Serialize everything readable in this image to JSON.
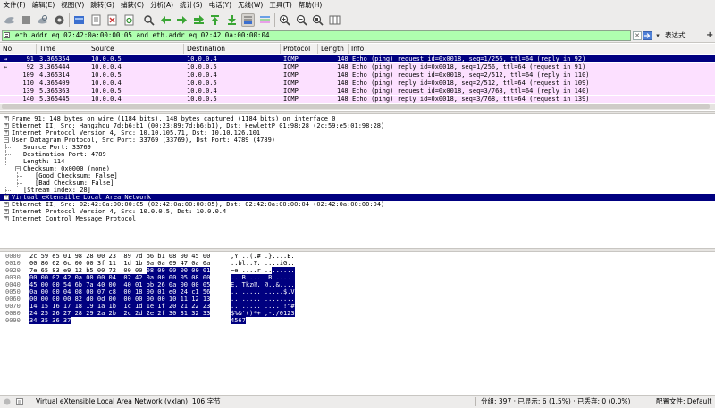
{
  "menu": [
    "文件(F)",
    "编辑(E)",
    "视图(V)",
    "跳转(G)",
    "捕获(C)",
    "分析(A)",
    "统计(S)",
    "电话(Y)",
    "无线(W)",
    "工具(T)",
    "帮助(H)"
  ],
  "toolbar_icons": [
    "shark-start-icon",
    "stop-icon",
    "restart-icon",
    "options-gear-icon",
    "open-file-icon",
    "save-file-icon",
    "close-file-icon",
    "reload-icon",
    "find-icon",
    "go-back-icon",
    "go-forward-icon",
    "go-to-packet-icon",
    "go-first-icon",
    "go-last-icon",
    "autoscroll-icon",
    "colorize-icon",
    "zoom-in-icon",
    "zoom-out-icon",
    "zoom-normal-icon",
    "resize-columns-icon"
  ],
  "filter": {
    "value": "eth.addr eq 02:42:0a:00:00:05 and eth.addr eq 02:42:0a:00:00:04",
    "expression_label": "表达式…",
    "add_label": "+"
  },
  "packet_list": {
    "columns": [
      "No.",
      "Time",
      "Source",
      "Destination",
      "Protocol",
      "Length",
      "Info"
    ],
    "rows": [
      {
        "marker": "→",
        "no": "91",
        "time": "3.365354",
        "src": "10.0.0.5",
        "dst": "10.0.0.4",
        "proto": "ICMP",
        "len": "148",
        "info": "Echo (ping) request  id=0x0018, seq=1/256, ttl=64 (reply in 92)",
        "selected": true
      },
      {
        "marker": "←",
        "no": "92",
        "time": "3.365444",
        "src": "10.0.0.4",
        "dst": "10.0.0.5",
        "proto": "ICMP",
        "len": "148",
        "info": "Echo (ping) reply    id=0x0018, seq=1/256, ttl=64 (request in 91)",
        "selected": false
      },
      {
        "marker": "",
        "no": "109",
        "time": "4.365314",
        "src": "10.0.0.5",
        "dst": "10.0.0.4",
        "proto": "ICMP",
        "len": "148",
        "info": "Echo (ping) request  id=0x0018, seq=2/512, ttl=64 (reply in 110)",
        "selected": false
      },
      {
        "marker": "",
        "no": "110",
        "time": "4.365409",
        "src": "10.0.0.4",
        "dst": "10.0.0.5",
        "proto": "ICMP",
        "len": "148",
        "info": "Echo (ping) reply    id=0x0018, seq=2/512, ttl=64 (request in 109)",
        "selected": false
      },
      {
        "marker": "",
        "no": "139",
        "time": "5.365363",
        "src": "10.0.0.5",
        "dst": "10.0.0.4",
        "proto": "ICMP",
        "len": "148",
        "info": "Echo (ping) request  id=0x0018, seq=3/768, ttl=64 (reply in 140)",
        "selected": false
      },
      {
        "marker": "",
        "no": "140",
        "time": "5.365445",
        "src": "10.0.0.4",
        "dst": "10.0.0.5",
        "proto": "ICMP",
        "len": "148",
        "info": "Echo (ping) reply    id=0x0018, seq=3/768, ttl=64 (request in 139)",
        "selected": false
      }
    ]
  },
  "details": [
    {
      "text": "Frame 91: 148 bytes on wire (1184 bits), 148 bytes captured (1184 bits) on interface 0",
      "level": 0,
      "expander": "+",
      "selected": false
    },
    {
      "text": "Ethernet II, Src: Hangzhou_7d:b6:b1 (00:23:89:7d:b6:b1), Dst: HewlettP_01:98:28 (2c:59:e5:01:98:28)",
      "level": 0,
      "expander": "+",
      "selected": false
    },
    {
      "text": "Internet Protocol Version 4, Src: 10.10.105.71, Dst: 10.10.126.101",
      "level": 0,
      "expander": "+",
      "selected": false
    },
    {
      "text": "User Datagram Protocol, Src Port: 33769 (33769), Dst Port: 4789 (4789)",
      "level": 0,
      "expander": "-",
      "selected": false
    },
    {
      "text": "Source Port: 33769",
      "level": 1,
      "expander": "",
      "selected": false
    },
    {
      "text": "Destination Port: 4789",
      "level": 1,
      "expander": "",
      "selected": false
    },
    {
      "text": "Length: 114",
      "level": 1,
      "expander": "",
      "selected": false
    },
    {
      "text": "Checksum: 0x0000 (none)",
      "level": 1,
      "expander": "-",
      "selected": false
    },
    {
      "text": "[Good Checksum: False]",
      "level": 2,
      "expander": "",
      "selected": false
    },
    {
      "text": "[Bad Checksum: False]",
      "level": 2,
      "expander": "",
      "selected": false
    },
    {
      "text": "[Stream index: 28]",
      "level": 1,
      "expander": "",
      "selected": false
    },
    {
      "text": "Virtual eXtensible Local Area Network",
      "level": 0,
      "expander": "+",
      "selected": true
    },
    {
      "text": "Ethernet II, Src: 02:42:0a:00:00:05 (02:42:0a:00:00:05), Dst: 02:42:0a:00:00:04 (02:42:0a:00:00:04)",
      "level": 0,
      "expander": "+",
      "selected": false
    },
    {
      "text": "Internet Protocol Version 4, Src: 10.0.0.5, Dst: 10.0.0.4",
      "level": 0,
      "expander": "+",
      "selected": false
    },
    {
      "text": "Internet Control Message Protocol",
      "level": 0,
      "expander": "+",
      "selected": false
    }
  ],
  "bytes": [
    {
      "offset": "0000",
      "hex_plain": "2c 59 e5 01 98 28 00 23  89 7d b6 b1 08 00 45 00",
      "hex_hl": "",
      "ascii_plain": ",Y...(.# .}....E.",
      "ascii_hl": ""
    },
    {
      "offset": "0010",
      "hex_plain": "00 86 62 6c 00 00 3f 11  1d 1b 0a 0a 69 47 0a 0a",
      "hex_hl": "",
      "ascii_plain": "..bl..?. ....iG..",
      "ascii_hl": ""
    },
    {
      "offset": "0020",
      "hex_plain": "7e 65 83 e9 12 b5 00 72  00 00 ",
      "hex_hl": "08 00 00 00 00 01",
      "ascii_plain": "~e.....r ..",
      "ascii_hl": "......"
    },
    {
      "offset": "0030",
      "hex_plain": "",
      "hex_hl": "00 00 02 42 0a 00 00 04  02 42 0a 00 00 05 08 00",
      "ascii_plain": "",
      "ascii_hl": "...B.... .B......"
    },
    {
      "offset": "0040",
      "hex_plain": "",
      "hex_hl": "45 00 00 54 6b 7a 40 00  40 01 bb 26 0a 00 00 05",
      "ascii_plain": "",
      "ascii_hl": "E..Tkz@. @..&...."
    },
    {
      "offset": "0050",
      "hex_plain": "",
      "hex_hl": "0a 00 00 04 08 00 07 c8  00 18 00 01 e0 24 c1 56",
      "ascii_plain": "",
      "ascii_hl": "........ .....$.V"
    },
    {
      "offset": "0060",
      "hex_plain": "",
      "hex_hl": "00 00 00 00 82 d0 0d 00  00 00 00 00 10 11 12 13",
      "ascii_plain": "",
      "ascii_hl": "........ ........"
    },
    {
      "offset": "0070",
      "hex_plain": "",
      "hex_hl": "14 15 16 17 18 19 1a 1b  1c 1d 1e 1f 20 21 22 23",
      "ascii_plain": "",
      "ascii_hl": "........ .... !\"#"
    },
    {
      "offset": "0080",
      "hex_plain": "",
      "hex_hl": "24 25 26 27 28 29 2a 2b  2c 2d 2e 2f 30 31 32 33",
      "ascii_plain": "",
      "ascii_hl": "$%&'()*+ ,-./0123"
    },
    {
      "offset": "0090",
      "hex_plain": "",
      "hex_hl": "34 35 36 37",
      "ascii_plain": "",
      "ascii_hl": "4567"
    }
  ],
  "status": {
    "selected_field": "Virtual eXtensible Local Area Network (vxlan), 106 字节",
    "packets": "分组: 397 · 已显示: 6 (1.5%) · 已丢弃: 0 (0.0%)",
    "profile": "配置文件: Default"
  },
  "colors": {
    "selected_bg": "#000080",
    "icmp_row": "#fce0ff",
    "filter_ok": "#afffaf"
  }
}
